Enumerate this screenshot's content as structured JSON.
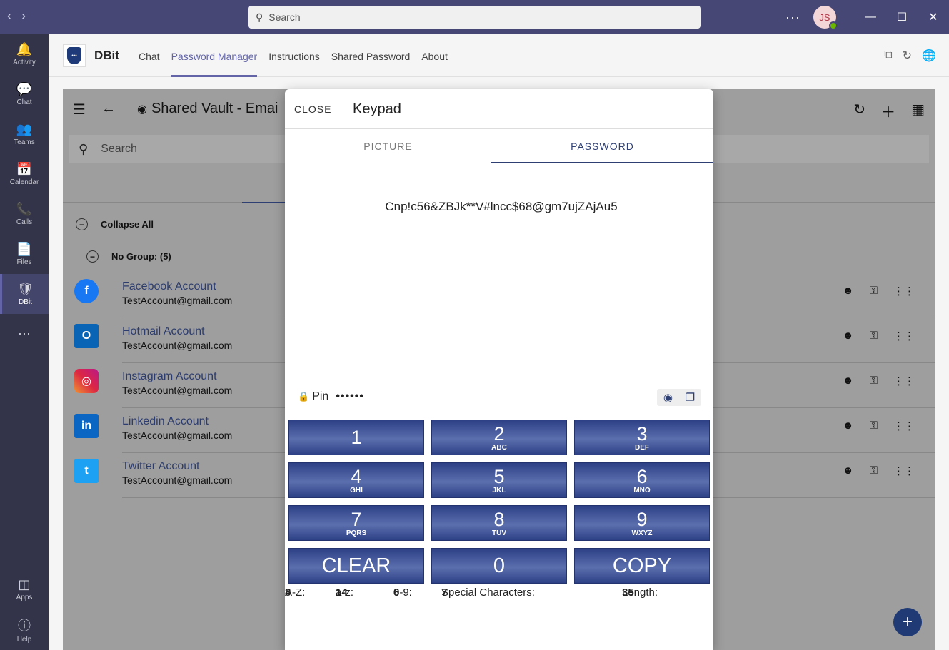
{
  "titlebar": {
    "search_placeholder": "Search",
    "more": "···",
    "avatar_initials": "JS"
  },
  "rail": {
    "items": [
      {
        "label": "Activity",
        "icon": "bell-icon",
        "glyph": "🔔"
      },
      {
        "label": "Chat",
        "icon": "chat-icon",
        "glyph": "💬"
      },
      {
        "label": "Teams",
        "icon": "teams-icon",
        "glyph": "👥"
      },
      {
        "label": "Calendar",
        "icon": "calendar-icon",
        "glyph": "📅"
      },
      {
        "label": "Calls",
        "icon": "phone-icon",
        "glyph": "📞"
      },
      {
        "label": "Files",
        "icon": "file-icon",
        "glyph": "📄"
      },
      {
        "label": "DBit",
        "icon": "shield-icon",
        "glyph": "🛡"
      }
    ],
    "more": "···",
    "apps_label": "Apps",
    "help_label": "Help"
  },
  "appbar": {
    "name": "DBit",
    "tabs": [
      "Chat",
      "Password Manager",
      "Instructions",
      "Shared Password",
      "About"
    ]
  },
  "vault": {
    "title": "Shared Vault - Emai",
    "search_placeholder": "Search",
    "collapse_all": "Collapse All",
    "group": "No Group: (5)",
    "accounts": [
      {
        "name": "Facebook Account",
        "email": "TestAccount@gmail.com",
        "logo_color": "#1877f2",
        "logo_text": "f"
      },
      {
        "name": "Hotmail Account",
        "email": "TestAccount@gmail.com",
        "logo_color": "#0a64b6",
        "logo_text": "O"
      },
      {
        "name": "Instagram Account",
        "email": "TestAccount@gmail.com",
        "logo_color": "#c13584",
        "logo_text": "◎"
      },
      {
        "name": "Linkedin Account",
        "email": "TestAccount@gmail.com",
        "logo_color": "#0a66c2",
        "logo_text": "in"
      },
      {
        "name": "Twitter Account",
        "email": "TestAccount@gmail.com",
        "logo_color": "#1da1f2",
        "logo_text": "t"
      }
    ]
  },
  "modal": {
    "close": "CLOSE",
    "title": "Keypad",
    "tabs": [
      "PICTURE",
      "PASSWORD"
    ],
    "password": "Cnp!c56&ZBJk**V#lncc$68@gm7ujZAjAu5",
    "pin_label": "Pin",
    "pin_dots": "••••••",
    "keys": [
      {
        "num": "1",
        "sub": ""
      },
      {
        "num": "2",
        "sub": "ABC"
      },
      {
        "num": "3",
        "sub": "DEF"
      },
      {
        "num": "4",
        "sub": "GHI"
      },
      {
        "num": "5",
        "sub": "JKL"
      },
      {
        "num": "6",
        "sub": "MNO"
      },
      {
        "num": "7",
        "sub": "PQRS"
      },
      {
        "num": "8",
        "sub": "TUV"
      },
      {
        "num": "9",
        "sub": "WXYZ"
      }
    ],
    "clear": "CLEAR",
    "zero": "0",
    "copy": "COPY",
    "stats": {
      "upper_label": "A-Z:",
      "upper": "8",
      "lower_label": "a-z:",
      "lower": "14",
      "digit_label": "0-9:",
      "digit": "6",
      "special_label": "Special Characters:",
      "special": "7",
      "length_label": "Length:",
      "length": "35"
    }
  },
  "colors": {
    "titlebar": "#464775",
    "rail": "#33344a",
    "accent": "#6264a7",
    "navy": "#2e3f74"
  }
}
